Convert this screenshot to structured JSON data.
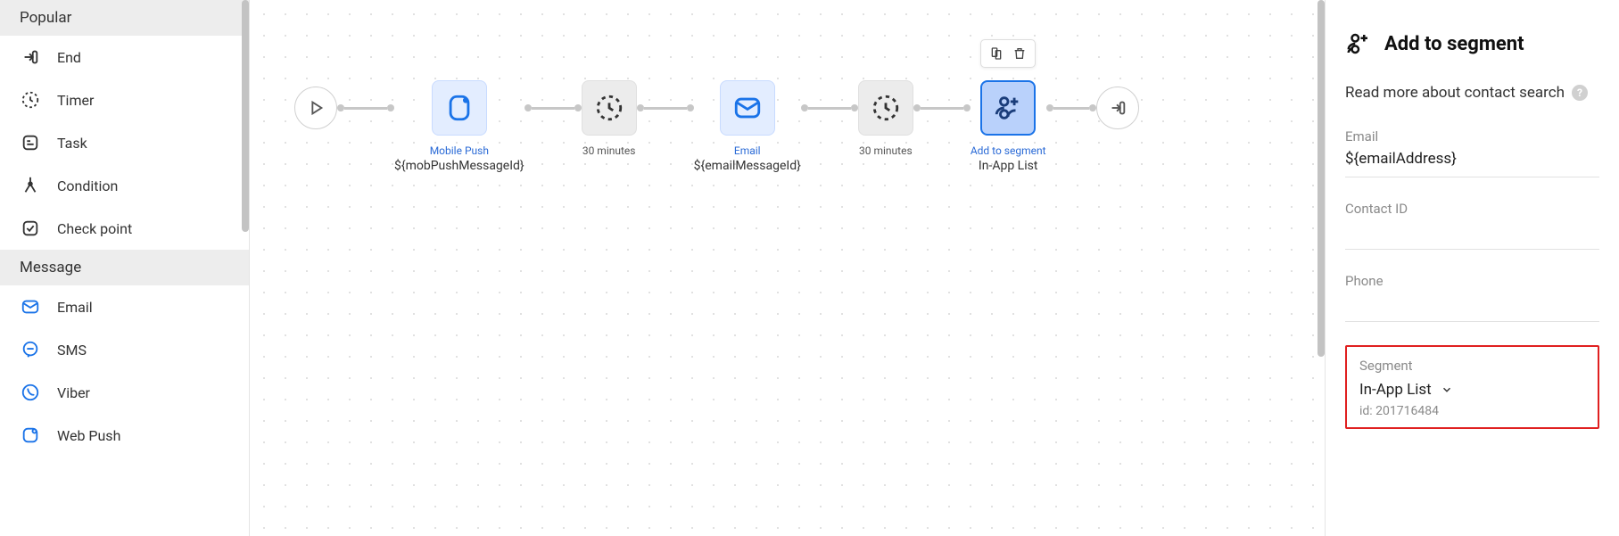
{
  "sidebar": {
    "sections": [
      {
        "title": "Popular",
        "items": [
          {
            "icon": "end-icon",
            "label": "End"
          },
          {
            "icon": "timer-icon",
            "label": "Timer"
          },
          {
            "icon": "task-icon",
            "label": "Task"
          },
          {
            "icon": "condition-icon",
            "label": "Condition"
          },
          {
            "icon": "checkpoint-icon",
            "label": "Check point"
          }
        ]
      },
      {
        "title": "Message",
        "items": [
          {
            "icon": "email-icon",
            "label": "Email"
          },
          {
            "icon": "sms-icon",
            "label": "SMS"
          },
          {
            "icon": "viber-icon",
            "label": "Viber"
          },
          {
            "icon": "webpush-icon",
            "label": "Web Push"
          }
        ]
      }
    ]
  },
  "flow": {
    "nodes": [
      {
        "type": "start",
        "shape": "circle",
        "top": "",
        "bottom": ""
      },
      {
        "type": "mobile_push",
        "shape": "box-blue",
        "top": "Mobile Push",
        "bottom": "${mobPushMessageId}"
      },
      {
        "type": "timer",
        "shape": "box-grey",
        "top": "30 minutes",
        "bottom": ""
      },
      {
        "type": "email",
        "shape": "box-blue",
        "top": "Email",
        "bottom": "${emailMessageId}"
      },
      {
        "type": "timer",
        "shape": "box-grey",
        "top": "30 minutes",
        "bottom": ""
      },
      {
        "type": "add_segment",
        "shape": "box-selected",
        "top": "Add to segment",
        "bottom": "In-App List",
        "selected": true
      },
      {
        "type": "end",
        "shape": "circle-end",
        "top": "",
        "bottom": ""
      }
    ]
  },
  "panel": {
    "title": "Add to segment",
    "read_more": "Read more about contact search",
    "fields": {
      "email_label": "Email",
      "email_value": "${emailAddress}",
      "contact_id_label": "Contact ID",
      "contact_id_value": "",
      "phone_label": "Phone",
      "phone_value": ""
    },
    "segment": {
      "label": "Segment",
      "selected": "In-App List",
      "id_prefix": "id: ",
      "id_value": "201716484"
    }
  }
}
